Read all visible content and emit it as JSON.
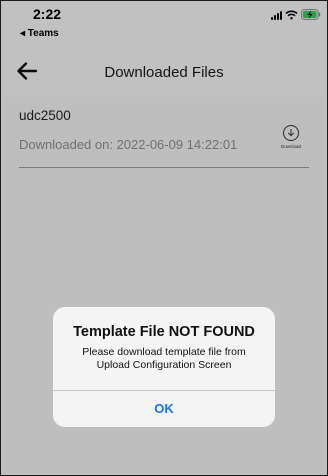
{
  "status_bar": {
    "time": "2:22",
    "back_app": "◂ Teams",
    "battery_color": "#34c759"
  },
  "nav": {
    "title": "Downloaded Files",
    "back_icon": "arrow-left-icon"
  },
  "files": [
    {
      "name": "udc2500",
      "downloaded": "Downloaded on: 2022-06-09 14:22:01",
      "action_label": "Download"
    }
  ],
  "alert": {
    "title": "Template File NOT FOUND",
    "message": "Please download template file from Upload Configuration Screen",
    "ok_label": "OK",
    "ok_color": "#1a73e8"
  }
}
